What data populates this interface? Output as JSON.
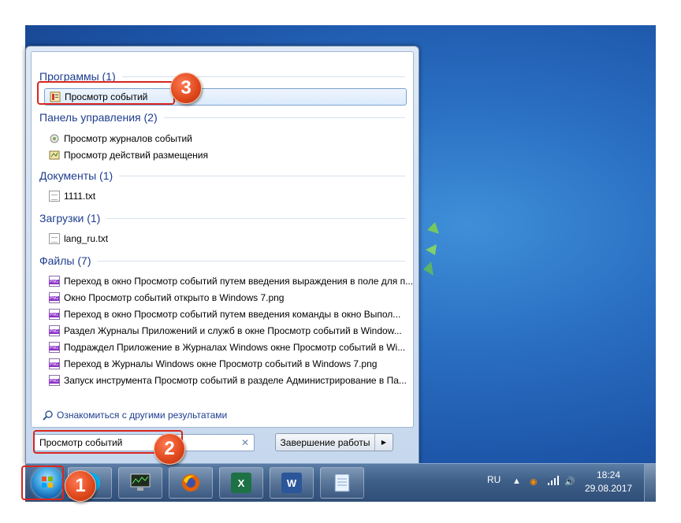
{
  "colors": {
    "accent": "#1e3d8f",
    "annotation": "#d8261e"
  },
  "groups": {
    "programs": {
      "header": "Программы (1)",
      "items": [
        "Просмотр событий"
      ]
    },
    "control_panel": {
      "header": "Панель управления (2)",
      "items": [
        "Просмотр журналов событий",
        "Просмотр действий размещения"
      ]
    },
    "documents": {
      "header": "Документы (1)",
      "items": [
        "1111.txt"
      ]
    },
    "downloads": {
      "header": "Загрузки (1)",
      "items": [
        "lang_ru.txt"
      ]
    },
    "files": {
      "header": "Файлы (7)",
      "items": [
        "Переход в окно Просмотр событий путем введения выраждения в поле для п...",
        "Окно Просмотр событий открыто в Windows 7.png",
        "Переход в окно Просмотр событий путем введения команды в окно Выпол...",
        "Раздел Журналы Приложений и служб в окне Просмотр событий в Window...",
        "Подраждел Приложение в Журналах Windows окне Просмотр событий в Wi...",
        "Переход в Журналы Windows окне Просмотр событий в Windows 7.png",
        "Запуск инструмента Просмотр событий в разделе Администрирование в Па..."
      ]
    }
  },
  "more_results": "Ознакомиться с другими результатами",
  "search": {
    "value": "Просмотр событий",
    "clear_icon": "close-icon"
  },
  "shutdown": {
    "label": "Завершение работы"
  },
  "taskbar": {
    "apps": [
      "skype-icon",
      "monitor-icon",
      "firefox-icon",
      "excel-icon",
      "word-icon",
      "notepad-icon"
    ],
    "excel_letter": "X",
    "word_letter": "W"
  },
  "tray": {
    "language": "RU",
    "time": "18:24",
    "date": "29.08.2017"
  },
  "annotations": {
    "one": "1",
    "two": "2",
    "three": "3"
  }
}
